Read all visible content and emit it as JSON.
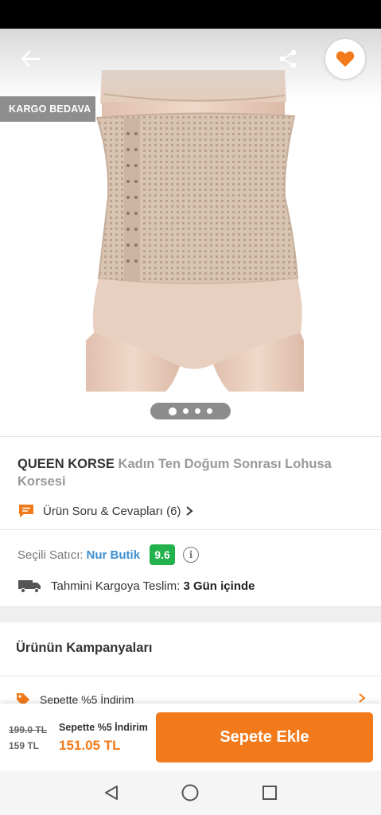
{
  "hero": {
    "badge": "KARGO BEDAVA",
    "image_count": 4,
    "active_image": 1,
    "icons": {
      "back": "arrow-left-icon",
      "share": "share-icon",
      "favorite": "heart-icon"
    }
  },
  "product": {
    "brand": "QUEEN KORSE",
    "name": "Kadın Ten Doğum Sonrası Lohusa Korsesi",
    "qa_label": "Ürün Soru & Cevapları (6)"
  },
  "seller": {
    "label": "Seçili Satıcı:",
    "name": "Nur Butik",
    "score": "9.6"
  },
  "shipping": {
    "label": "Tahmini Kargoya Teslim:",
    "value": "3 Gün içinde"
  },
  "campaigns": {
    "title": "Ürünün Kampanyaları",
    "items": [
      {
        "label": "Sepette %5 İndirim"
      }
    ]
  },
  "bottom_bar": {
    "old_price": "199.0 TL",
    "price": "159 TL",
    "discount_label": "Sepette %5 İndirim",
    "discount_price": "151.05 TL",
    "add_to_cart": "Sepete Ekle"
  },
  "colors": {
    "accent": "#f27a1a",
    "seller_link": "#3d8fd1",
    "score_bg": "#22b14c",
    "badge_bg": "#8e8e8e"
  }
}
